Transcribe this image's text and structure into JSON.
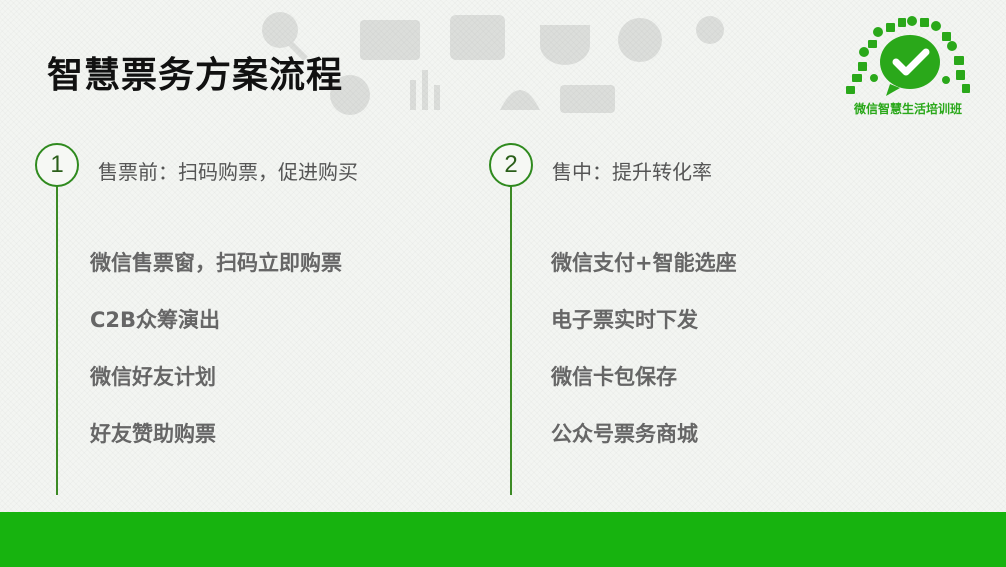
{
  "slide": {
    "title": "智慧票务方案流程",
    "logo": {
      "caption": "微信智慧生活培训班",
      "icon": "wechat-logo",
      "color": "#2aa81a"
    },
    "steps": [
      {
        "number": "1",
        "heading": "售票前：扫码购票，促进购买",
        "items": [
          "微信售票窗，扫码立即购票",
          "C2B众筹演出",
          "微信好友计划",
          "好友赞助购票"
        ]
      },
      {
        "number": "2",
        "heading": "售中：提升转化率",
        "items": [
          "微信支付+智能选座",
          "电子票实时下发",
          "微信卡包保存",
          "公众号票务商城"
        ]
      }
    ],
    "colors": {
      "accent_green": "#2f8a1e",
      "footer_green": "#17b30f"
    }
  }
}
